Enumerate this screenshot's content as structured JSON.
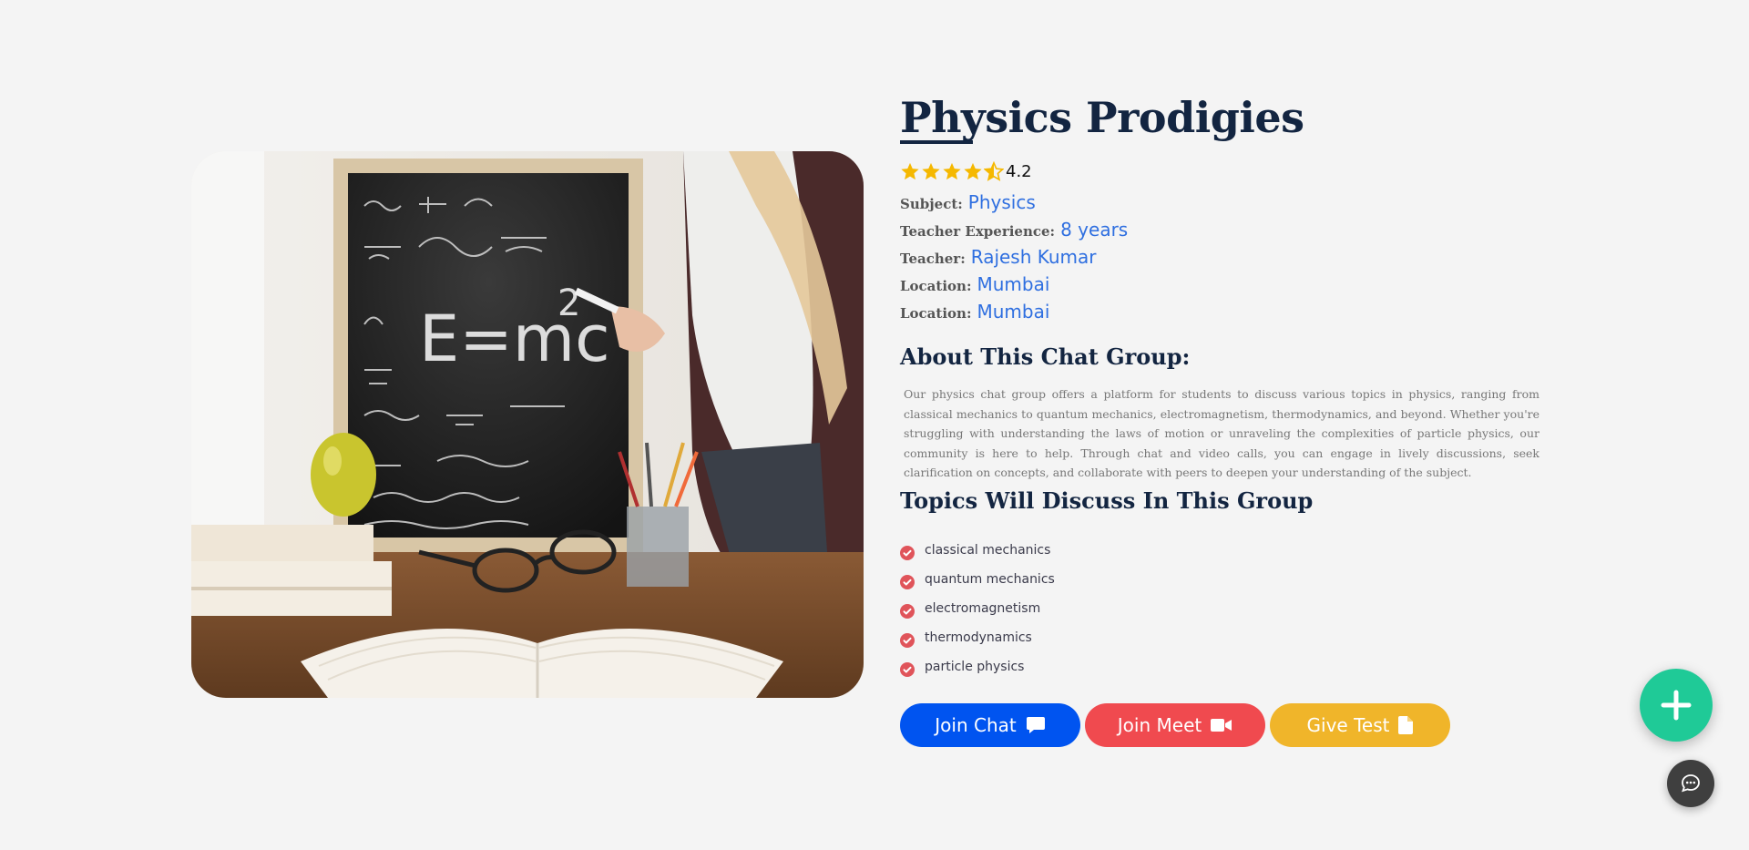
{
  "group": {
    "title": "Physics Prodigies",
    "rating": "4.2",
    "rating_stars": 4.2
  },
  "meta": [
    {
      "label": "Subject:",
      "value": "Physics"
    },
    {
      "label": "Teacher Experience:",
      "value": "8 years"
    },
    {
      "label": "Teacher:",
      "value": "Rajesh Kumar"
    },
    {
      "label": "Location:",
      "value": "Mumbai"
    },
    {
      "label": "Location:",
      "value": "Mumbai"
    }
  ],
  "about": {
    "heading": "About This Chat Group:",
    "text": "Our physics chat group offers a platform for students to discuss various topics in physics, ranging from classical mechanics to quantum mechanics, electromagnetism, thermodynamics, and beyond. Whether you're struggling with understanding the laws of motion or unraveling the complexities of particle physics, our community is here to help. Through chat and video calls, you can engage in lively discussions, seek clarification on concepts, and collaborate with peers to deepen your understanding of the subject."
  },
  "topics": {
    "heading": "Topics Will Discuss In This Group",
    "items": [
      "classical mechanics",
      "quantum mechanics",
      "electromagnetism",
      "thermodynamics",
      "particle physics"
    ]
  },
  "actions": {
    "join_chat": "Join Chat",
    "join_meet": "Join Meet",
    "give_test": "Give Test"
  },
  "hero": {
    "chalkboard_equation": "E=mc",
    "chalkboard_exponent": "2"
  },
  "icons": {
    "chat_button_icon": "chat-bubble-icon",
    "meet_button_icon": "video-camera-icon",
    "test_button_icon": "document-icon",
    "fab_icon": "plus-icon",
    "support_icon": "chat-dots-icon",
    "topic_icon": "check-circle-icon"
  },
  "colors": {
    "title": "#132541",
    "accent_link": "#2f6fe0",
    "star": "#f5b800",
    "join_chat": "#0054f0",
    "join_meet": "#f04a4f",
    "give_test": "#f0b52a",
    "fab": "#1fca97",
    "check": "#e0545a"
  }
}
